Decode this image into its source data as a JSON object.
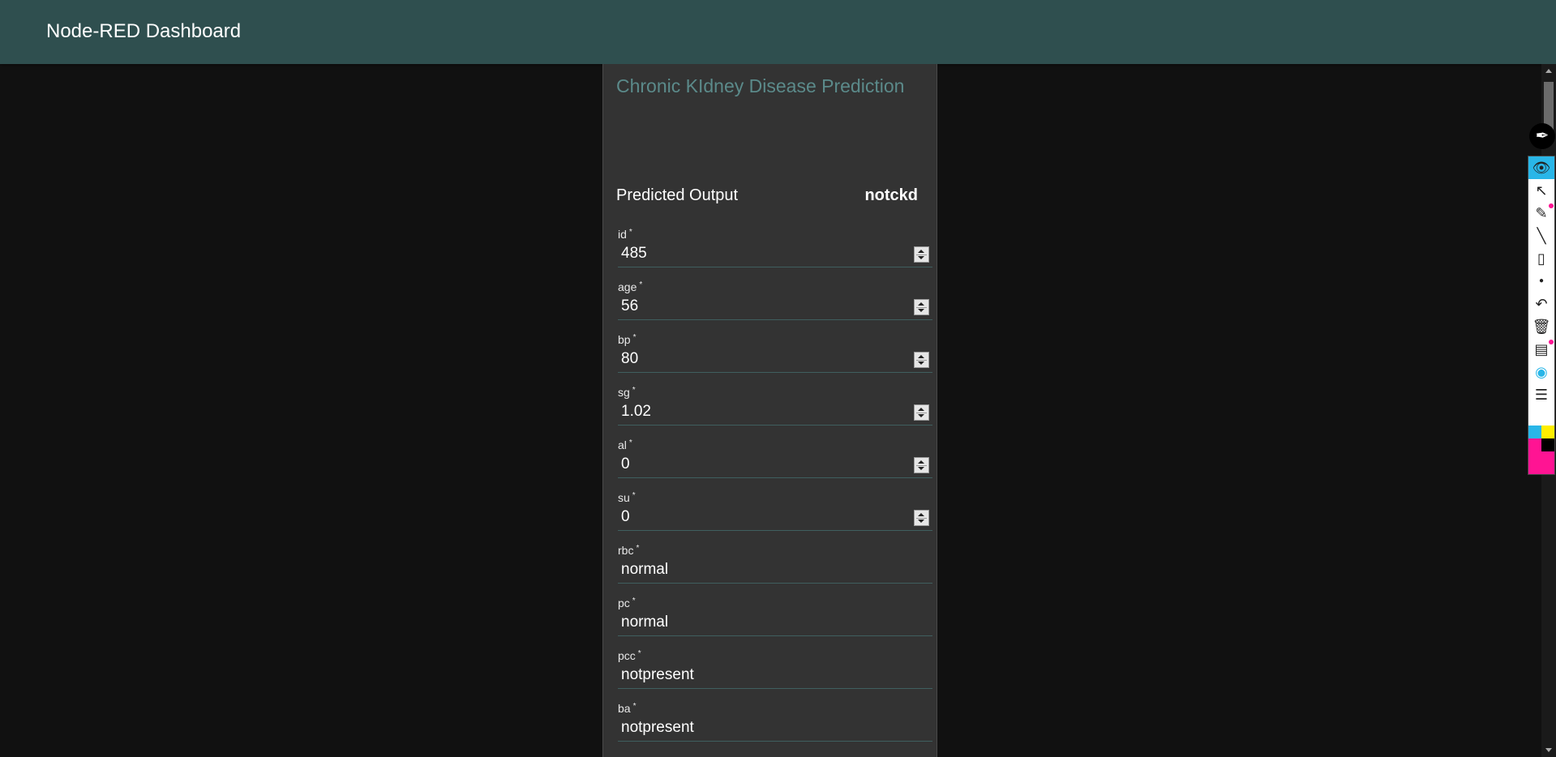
{
  "header": {
    "title": "Node-RED Dashboard"
  },
  "card": {
    "title": "Chronic KIdney Disease Prediction",
    "predicted": {
      "label": "Predicted Output",
      "value": "notckd"
    },
    "fields": [
      {
        "label": "id",
        "required": "*",
        "value": "485",
        "numeric": true
      },
      {
        "label": "age",
        "required": "*",
        "value": "56",
        "numeric": true
      },
      {
        "label": "bp",
        "required": "*",
        "value": "80",
        "numeric": true
      },
      {
        "label": "sg",
        "required": "*",
        "value": "1.02",
        "numeric": true
      },
      {
        "label": "al",
        "required": "*",
        "value": "0",
        "numeric": true
      },
      {
        "label": "su",
        "required": "*",
        "value": "0",
        "numeric": true
      },
      {
        "label": "rbc",
        "required": "*",
        "value": "normal",
        "numeric": false
      },
      {
        "label": "pc",
        "required": "*",
        "value": "normal",
        "numeric": false
      },
      {
        "label": "pcc",
        "required": "*",
        "value": "notpresent",
        "numeric": false
      },
      {
        "label": "ba",
        "required": "*",
        "value": "notpresent",
        "numeric": false
      }
    ]
  },
  "toolbar": {
    "icons": [
      "pen-icon",
      "eye-icon",
      "cursor-icon",
      "highlighter-icon",
      "line-icon",
      "eraser-icon",
      "dot-icon",
      "undo-icon",
      "trash-icon",
      "board-icon",
      "camera-icon",
      "clipboard-icon"
    ],
    "colors": {
      "cyan": "#29b6e8",
      "yellow": "#ffee00",
      "black": "#000000",
      "magenta": "#ff1493"
    }
  },
  "colors": {
    "header": "#2f4f4f",
    "background": "#111111",
    "card": "#333333",
    "title_accent": "#5b8a8a"
  }
}
